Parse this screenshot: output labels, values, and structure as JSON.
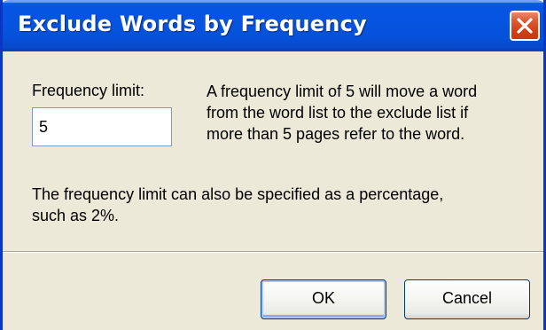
{
  "dialog": {
    "title": "Exclude Words by Frequency",
    "close_icon": "close-icon"
  },
  "form": {
    "frequency_label": "Frequency limit:",
    "frequency_value": "5",
    "description": "A frequency limit of 5 will move a word\nfrom the word list to the exclude list if\nmore than 5 pages refer to the word.",
    "note": "The frequency limit can also be specified as a percentage,\nsuch as 2%."
  },
  "buttons": {
    "ok_label": "OK",
    "cancel_label": "Cancel"
  },
  "colors": {
    "titlebar": "#0655e3",
    "dialog_background": "#ece9d8",
    "close_button": "#d04015",
    "default_button_border": "#87aaf0"
  }
}
